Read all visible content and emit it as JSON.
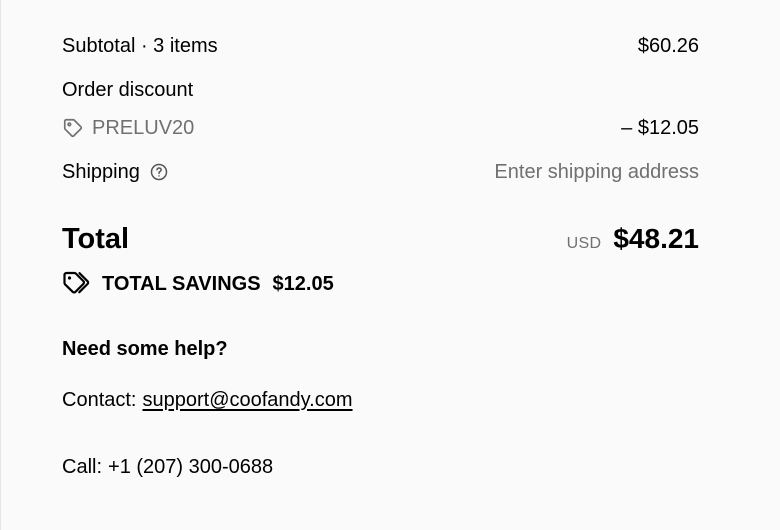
{
  "summary": {
    "subtotal_label": "Subtotal · 3 items",
    "subtotal_value": "$60.26",
    "order_discount_label": "Order discount",
    "discount_code": "PRELUV20",
    "discount_value": "– $12.05",
    "shipping_label": "Shipping",
    "shipping_value": "Enter shipping address",
    "total_label": "Total",
    "currency": "USD",
    "total_value": "$48.21",
    "savings_label": "TOTAL SAVINGS",
    "savings_value": "$12.05"
  },
  "help": {
    "title": "Need some help?",
    "contact_label": "Contact:",
    "contact_email": "support@coofandy.com",
    "call_label": "Call:",
    "call_number": "+1 (207) 300-0688"
  },
  "icons": {
    "discount": "tag-icon",
    "shipping_help": "question-circle-icon",
    "savings": "double-tag-icon"
  },
  "colors": {
    "background": "#fafafa",
    "text": "#000000",
    "muted": "#707070"
  }
}
